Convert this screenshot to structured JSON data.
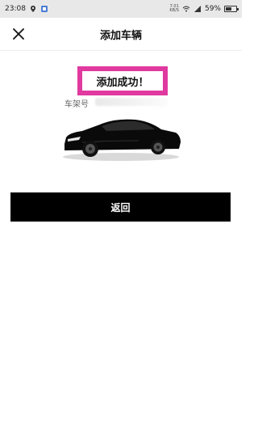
{
  "status_bar": {
    "time": "23:08",
    "net_speed_top": "7.01",
    "net_speed_bottom": "KB/S",
    "battery": "59%",
    "battery_level": 0.59
  },
  "header": {
    "title": "添加车辆",
    "close_icon": "close-icon"
  },
  "success": {
    "message": "添加成功！",
    "highlight_color": "#e0399f"
  },
  "vehicle": {
    "vin_label": "车架号"
  },
  "actions": {
    "back_label": "返回"
  }
}
